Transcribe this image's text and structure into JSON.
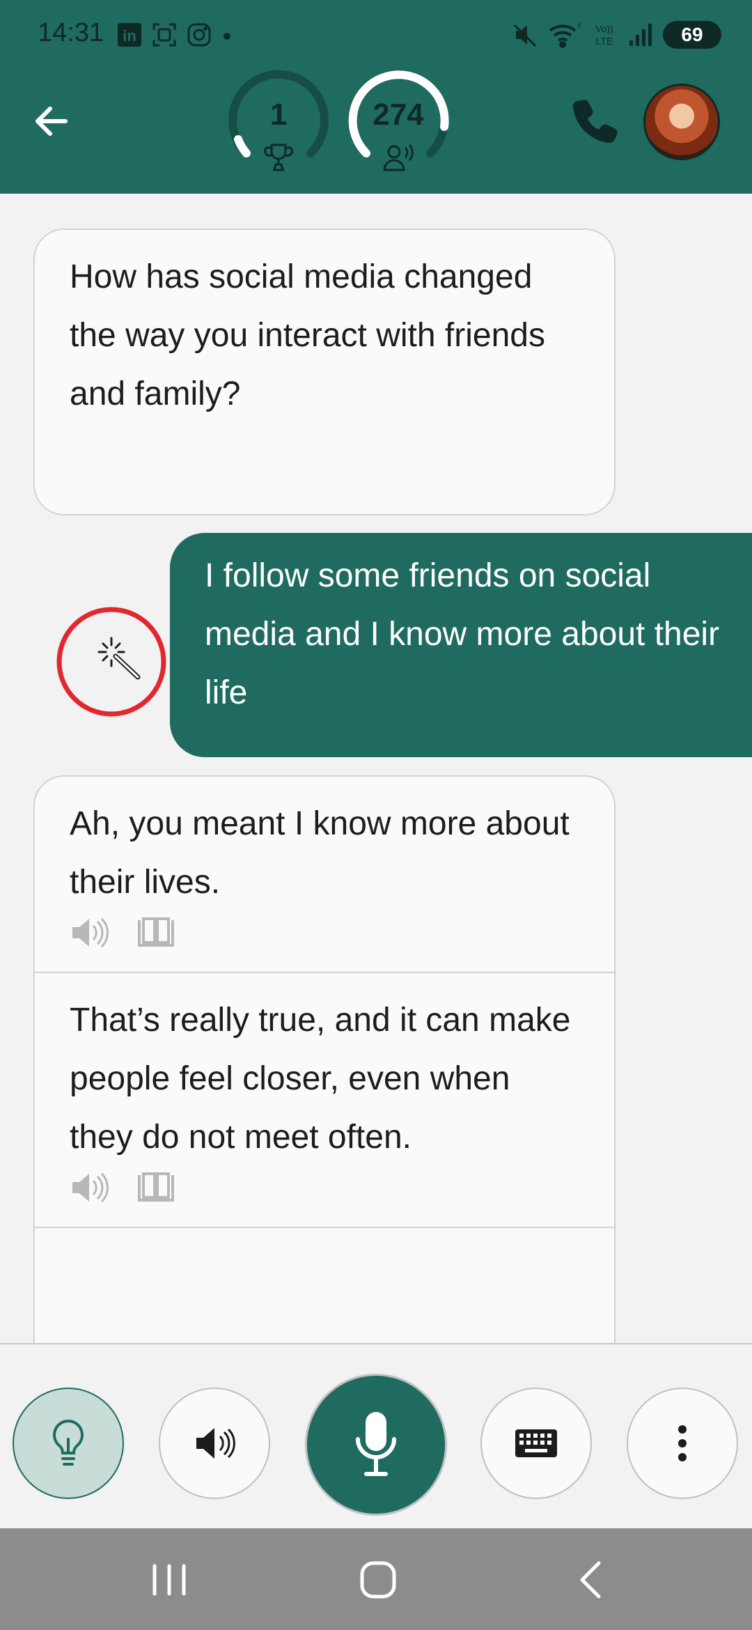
{
  "status_bar": {
    "time": "14:31",
    "battery": "69",
    "icons": [
      "linkedin-icon",
      "screen-capture-icon",
      "instagram-icon",
      "dot-icon",
      "mute-icon",
      "wifi-icon",
      "volte-icon",
      "signal-icon"
    ]
  },
  "header": {
    "score_trophies": "1",
    "score_words": "274",
    "colors": {
      "primary": "#1f6b60",
      "gauge_track": "#164d45",
      "gauge_fill": "#ffffff"
    }
  },
  "messages": [
    {
      "role": "bot",
      "text": "How has social media changed the way you interact with friends and family?"
    },
    {
      "role": "user",
      "text": "I follow some friends on social media and I know more about their life"
    },
    {
      "role": "bot",
      "text": "Ah, you meant I know more about their lives."
    },
    {
      "role": "bot",
      "text": "That’s really true, and it can make people feel closer, even when they do not meet often."
    }
  ],
  "toolbar": {
    "buttons": [
      "hint-button",
      "speaker-button",
      "microphone-button",
      "keyboard-button",
      "more-options-button"
    ]
  }
}
